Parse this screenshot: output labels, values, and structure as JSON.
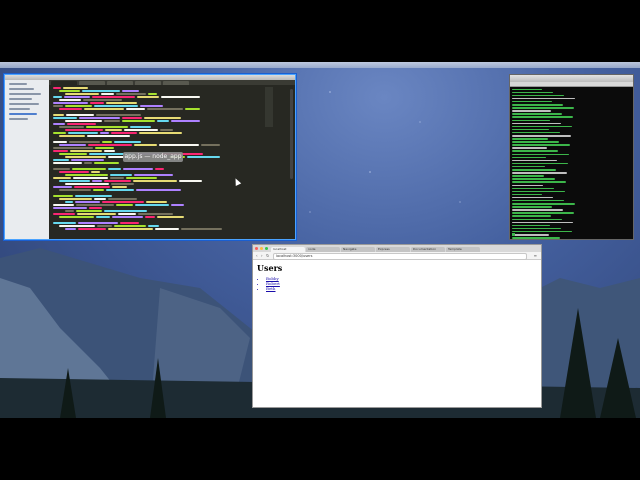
{
  "editor": {
    "tooltip": "app.js — node_app",
    "sidebar_items": 8,
    "tabs": 5
  },
  "browser": {
    "tabs": [
      {
        "label": "localhost"
      },
      {
        "label": "node"
      },
      {
        "label": "Navigate"
      },
      {
        "label": "Express"
      },
      {
        "label": "Documentation"
      },
      {
        "label": "Template"
      }
    ],
    "url": "localhost:3000/users",
    "page": {
      "heading": "Users",
      "users": [
        "Bobby",
        "Robert",
        "Beth"
      ]
    }
  },
  "colors": {
    "accent": "#4aa3ff",
    "terminal_text": "#3cb64a",
    "link": "#1a0dab"
  }
}
